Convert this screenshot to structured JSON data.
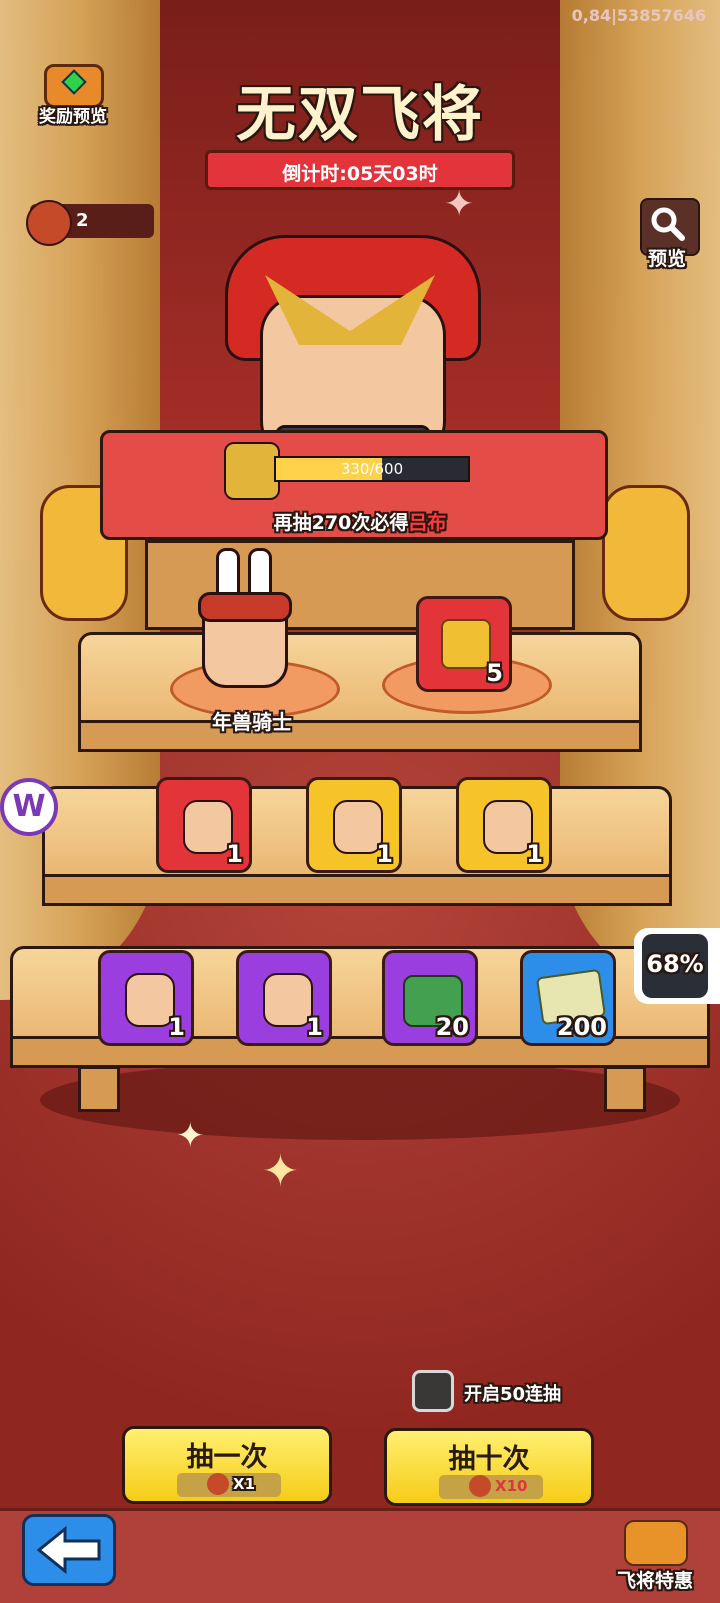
{
  "status_overlay": "0,84|53857646",
  "rewards_preview": {
    "label": "奖励预览"
  },
  "title": {
    "text": "无双飞将",
    "countdown": "倒计时:05天03时"
  },
  "token": {
    "count": "2"
  },
  "preview_button": {
    "label": "预览"
  },
  "progress": {
    "text": "330/600",
    "fraction": 0.55,
    "guarantee_prefix": "再抽270次必得",
    "guarantee_hero": "吕布"
  },
  "shelf1": {
    "hero_name": "年兽骑士",
    "item_count": "5"
  },
  "shelf2": {
    "counts": [
      "1",
      "1",
      "1"
    ]
  },
  "shelf3": {
    "counts": [
      "1",
      "1",
      "20",
      "200"
    ]
  },
  "side_badge": {
    "percent": "68%"
  },
  "toggle50": {
    "label": "开启50连抽",
    "checked": false
  },
  "draw_one": {
    "label": "抽一次",
    "cost": "X1"
  },
  "draw_ten": {
    "label": "抽十次",
    "cost": "X10"
  },
  "bottom": {
    "shop_label": "飞将特惠"
  },
  "colors": {
    "accent_red": "#e2343a",
    "gold": "#f6cc18",
    "purple": "#9b3ee0",
    "blue": "#2c8ee8"
  }
}
